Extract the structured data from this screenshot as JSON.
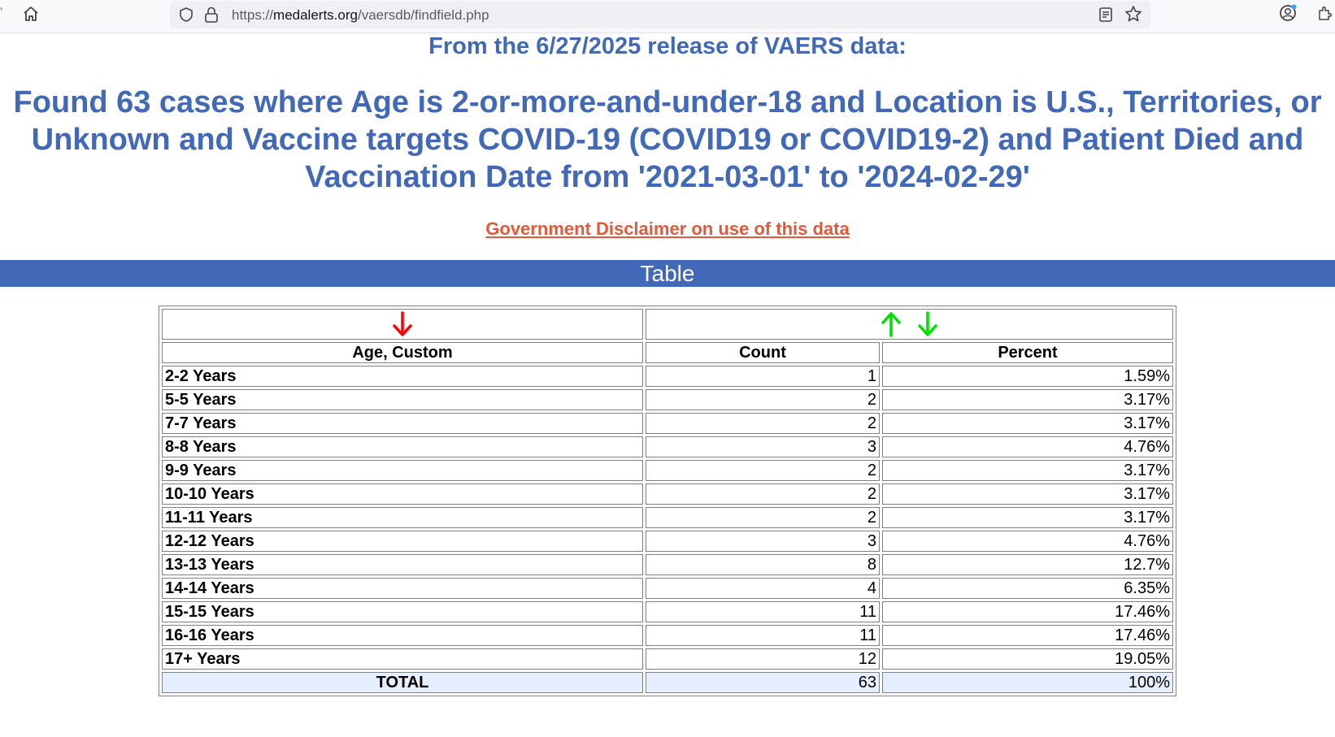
{
  "browser": {
    "url_prefix": "https://",
    "url_domain": "medalerts.org",
    "url_path": "/vaersdb/findfield.php"
  },
  "heading": {
    "release": "From the 6/27/2025 release of VAERS data:",
    "found": "Found 63 cases where Age is 2-or-more-and-under-18 and Location is U.S., Territories, or Unknown and Vaccine targets COVID-19 (COVID19 or COVID19-2) and Patient Died and Vaccination Date from '2021-03-01' to '2024-02-29'",
    "disclaimer": "Government Disclaimer on use of this data",
    "table_band": "Table"
  },
  "colors": {
    "heading_blue": "#4169b8",
    "disclaimer_red": "#e05a3c",
    "sort_down_active": "#ff0000",
    "sort_green": "#00dd00",
    "total_row_bg": "#e6efff"
  },
  "table": {
    "columns": {
      "age": "Age, Custom",
      "count": "Count",
      "percent": "Percent"
    },
    "rows": [
      {
        "age": "2-2 Years",
        "count": "1",
        "percent": "1.59%"
      },
      {
        "age": "5-5 Years",
        "count": "2",
        "percent": "3.17%"
      },
      {
        "age": "7-7 Years",
        "count": "2",
        "percent": "3.17%"
      },
      {
        "age": "8-8 Years",
        "count": "3",
        "percent": "4.76%"
      },
      {
        "age": "9-9 Years",
        "count": "2",
        "percent": "3.17%"
      },
      {
        "age": "10-10 Years",
        "count": "2",
        "percent": "3.17%"
      },
      {
        "age": "11-11 Years",
        "count": "2",
        "percent": "3.17%"
      },
      {
        "age": "12-12 Years",
        "count": "3",
        "percent": "4.76%"
      },
      {
        "age": "13-13 Years",
        "count": "8",
        "percent": "12.7%"
      },
      {
        "age": "14-14 Years",
        "count": "4",
        "percent": "6.35%"
      },
      {
        "age": "15-15 Years",
        "count": "11",
        "percent": "17.46%"
      },
      {
        "age": "16-16 Years",
        "count": "11",
        "percent": "17.46%"
      },
      {
        "age": "17+ Years",
        "count": "12",
        "percent": "19.05%"
      }
    ],
    "total": {
      "label": "TOTAL",
      "count": "63",
      "percent": "100%"
    }
  }
}
